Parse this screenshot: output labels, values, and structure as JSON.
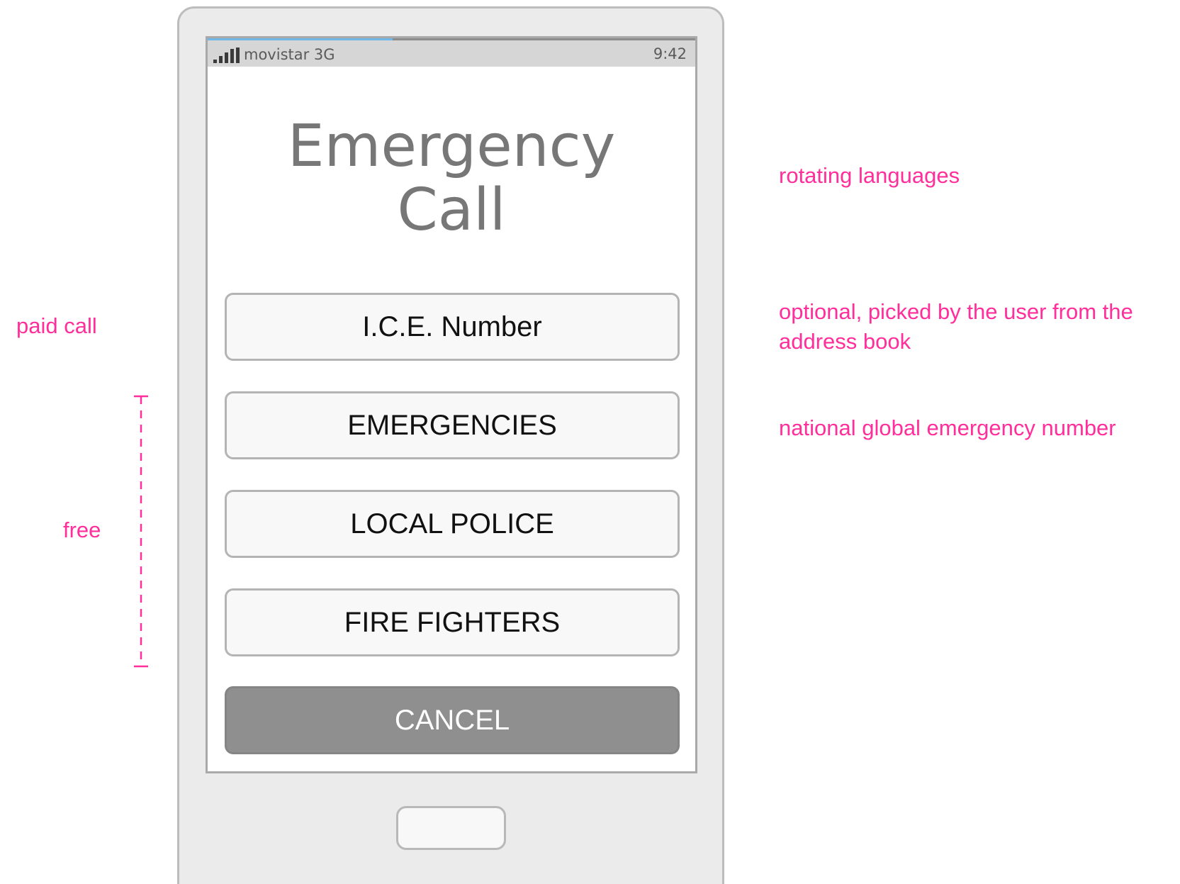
{
  "status_bar": {
    "carrier": "movistar 3G",
    "time": "9:42",
    "signal_icon": "signal-bars-icon"
  },
  "screen": {
    "title_line1": "Emergency",
    "title_line2": "Call",
    "buttons": {
      "ice": "I.C.E. Number",
      "emergencies": "EMERGENCIES",
      "local_police": "LOCAL POLICE",
      "fire_fighters": "FIRE FIGHTERS",
      "cancel": "CANCEL"
    }
  },
  "annotations": {
    "rotating_languages": "rotating languages",
    "ice_note_line1": "optional, picked by the user from the",
    "ice_note_line2": "address book",
    "national_number": "national global emergency number",
    "paid_call": "paid call",
    "free": "free"
  },
  "colors": {
    "annotation": "#ff2e9a",
    "cancel_button": "#8f8f8f",
    "status_bar": "#d6d6d6"
  }
}
